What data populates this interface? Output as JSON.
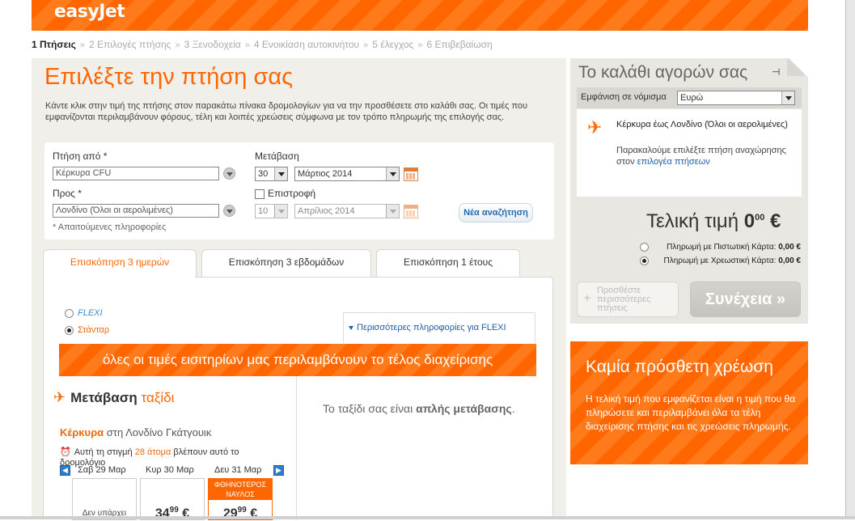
{
  "header": {
    "logo": "easyJet"
  },
  "steps": [
    {
      "label": "1 Πτήσεις",
      "active": true
    },
    {
      "label": "2 Επιλογές πτήσης",
      "active": false
    },
    {
      "label": "3 Ξενοδοχεία",
      "active": false
    },
    {
      "label": "4 Ενοικίαση αυτοκινήτου",
      "active": false
    },
    {
      "label": "5 έλεγχος",
      "active": false
    },
    {
      "label": "6 Επιβεβαίωση",
      "active": false
    }
  ],
  "main": {
    "title": "Επιλέξτε την πτήση σας",
    "intro": "Κάντε κλικ στην τιμή της πτήσης στον παρακάτω πίνακα δρομολογίων για να την προσθέσετε στο καλάθι σας. Οι τιμές που εμφανίζονται περιλαμβάνουν φόρους, τέλη και λοιπές χρεώσεις σύμφωνα με τον τρόπο πληρωμής της επιλογής σας."
  },
  "search": {
    "from_label": "Πτήση από *",
    "from_value": "Κέρκυρα CFU",
    "to_label": "Προς *",
    "to_value": "Λονδίνο (Όλοι οι αερολιμένες)",
    "outbound_label": "Μετάβαση",
    "outbound_day": "30",
    "outbound_month": "Μάρτιος 2014",
    "return_label": "Επιστροφή",
    "return_day": "10",
    "return_month": "Απρίλιος 2014",
    "new_search": "Νέα αναζήτηση",
    "required_note": "* Απαιτούμενες πληροφορίες"
  },
  "tabs": [
    {
      "label": "Επισκόπηση 3 ημερών",
      "active": true
    },
    {
      "label": "Επισκόπηση 3 εβδομάδων",
      "active": false
    },
    {
      "label": "Επισκόπηση 1 έτους",
      "active": false
    }
  ],
  "fare_type": {
    "flexi": "FLEXI",
    "standard": "Στάνταρ",
    "selected": "standard",
    "more_info": "Περισσότερες πληροφορίες για FLEXI"
  },
  "fees_banner": "όλες οι τιμές εισιτηρίων μας περιλαμβάνουν το τέλος διαχείρισης",
  "outbound": {
    "heading": "Μετάβαση",
    "heading_sub": "ταξίδι",
    "route_from": "Κέρκυρα",
    "route_rest": "στη Λονδίνο Γκάτγουικ",
    "watching_pre": "Αυτή τη στιγμή",
    "watching_count": "28 άτομα",
    "watching_post": "βλέπουν αυτό το δρομολόγιο",
    "days": [
      {
        "label": "Σαβ 29 Μαρ",
        "price_main": "",
        "price_cents": "",
        "na": "Δεν υπάρχει"
      },
      {
        "label": "Κυρ 30 Μαρ",
        "price_main": "34",
        "price_cents": "99",
        "currency": "€"
      },
      {
        "label": "Δευ 31 Μαρ",
        "price_main": "29",
        "price_cents": "99",
        "currency": "€",
        "badge": "ΦΘΗΝΟΤΕΡΟΣ ΝΑΥΛΟΣ"
      }
    ]
  },
  "oneway": {
    "pre": "Το ταξίδι σας είναι",
    "bold": "απλής μετάβασης",
    "post": "."
  },
  "basket": {
    "title": "Το καλάθι αγορών σας",
    "currency_label": "Εμφάνιση σε νόμισμα",
    "currency_value": "Ευρώ",
    "route": "Κέρκυρα έως Λονδίνο (Όλοι οι αερολιμένες)",
    "note_pre": "Παρακαλούμε επιλέξτε πτήση αναχώρησης στον",
    "note_link": "επιλογέα πτήσεων",
    "total_label": "Τελική τιμή",
    "total_main": "0",
    "total_cents": "00",
    "total_currency": "€",
    "pay_credit_label": "Πληρωμή με Πιστωτική Κάρτα:",
    "pay_credit_value": "0,00 €",
    "pay_debit_label": "Πληρωμή με Χρεωστική Κάρτα:",
    "pay_debit_value": "0,00 €",
    "add_more": "Προσθέστε περισσότερες πτήσεις",
    "continue": "Συνέχεια »"
  },
  "promo": {
    "title": "Καμία πρόσθετη χρέωση",
    "text": "Η τελική τιμή που εμφανίζεται είναι η τιμή που θα πληρώσετε και περιλαμβάνει όλα τα τέλη διαχείρισης πτήσης και τις χρεώσεις πληρωμής."
  },
  "colors": {
    "brand": "#ff6600",
    "link": "#1f5fa8"
  }
}
